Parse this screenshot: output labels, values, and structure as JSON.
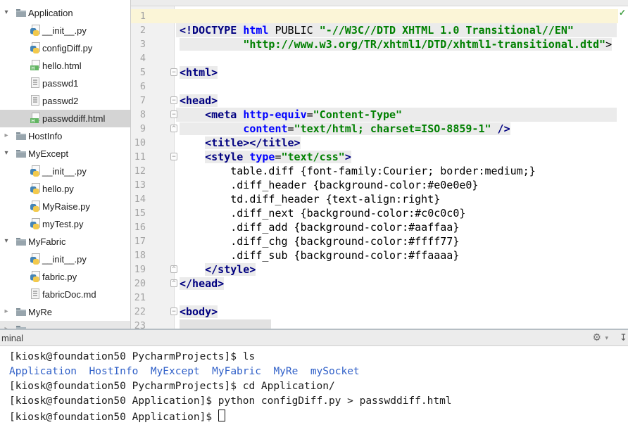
{
  "sidebar": {
    "items": [
      {
        "label": "Application",
        "icon": "folder-icon",
        "kind": "folder",
        "state": "expanded",
        "level": 0
      },
      {
        "label": "__init__.py",
        "icon": "python-file-icon",
        "kind": "file",
        "level": 1
      },
      {
        "label": "configDiff.py",
        "icon": "python-file-icon",
        "kind": "file",
        "level": 1
      },
      {
        "label": "hello.html",
        "icon": "html-file-icon",
        "kind": "file",
        "level": 1
      },
      {
        "label": "passwd1",
        "icon": "text-file-icon",
        "kind": "file",
        "level": 1
      },
      {
        "label": "passwd2",
        "icon": "text-file-icon",
        "kind": "file",
        "level": 1
      },
      {
        "label": "passwddiff.html",
        "icon": "html-file-icon",
        "kind": "file",
        "level": 1,
        "selected": true
      },
      {
        "label": "HostInfo",
        "icon": "folder-icon",
        "kind": "folder",
        "state": "collapsed",
        "level": 0
      },
      {
        "label": "MyExcept",
        "icon": "folder-icon",
        "kind": "folder",
        "state": "expanded",
        "level": 0
      },
      {
        "label": "__init__.py",
        "icon": "python-file-icon",
        "kind": "file",
        "level": 1
      },
      {
        "label": "hello.py",
        "icon": "python-file-icon",
        "kind": "file",
        "level": 1
      },
      {
        "label": "MyRaise.py",
        "icon": "python-file-icon",
        "kind": "file",
        "level": 1
      },
      {
        "label": "myTest.py",
        "icon": "python-file-icon",
        "kind": "file",
        "level": 1
      },
      {
        "label": "MyFabric",
        "icon": "folder-icon",
        "kind": "folder",
        "state": "expanded",
        "level": 0
      },
      {
        "label": "__init__.py",
        "icon": "python-file-icon",
        "kind": "file",
        "level": 1
      },
      {
        "label": "fabric.py",
        "icon": "python-file-icon",
        "kind": "file",
        "level": 1
      },
      {
        "label": "fabricDoc.md",
        "icon": "text-file-icon",
        "kind": "file",
        "level": 1
      },
      {
        "label": "MyRe",
        "icon": "folder-icon",
        "kind": "folder",
        "state": "collapsed",
        "level": 0
      },
      {
        "label": "",
        "icon": "folder-icon",
        "kind": "folder",
        "state": "collapsed",
        "level": 0,
        "partial": true
      }
    ]
  },
  "editor": {
    "inspection_icon": "inspections-ok-icon",
    "lines": [
      {
        "n": 1,
        "caret": true,
        "segs": []
      },
      {
        "n": 2,
        "bg": "full",
        "segs": [
          [
            "t",
            "<!DOCTYPE "
          ],
          [
            "k",
            "html"
          ],
          [
            "p",
            " PUBLIC "
          ],
          [
            "s",
            "\"-//W3C//DTD XHTML 1.0 Transitional//EN\""
          ]
        ]
      },
      {
        "n": 3,
        "hl": 0,
        "segs": [
          [
            "p",
            "          "
          ],
          [
            "s",
            "\"http://www.w3.org/TR/xhtml1/DTD/xhtml1-transitional.dtd\""
          ],
          [
            "p",
            ">"
          ]
        ]
      },
      {
        "n": 4,
        "segs": []
      },
      {
        "n": 5,
        "fold": "start",
        "hl": 0,
        "segs": [
          [
            "t",
            "<html>"
          ]
        ]
      },
      {
        "n": 6,
        "segs": []
      },
      {
        "n": 7,
        "fold": "start",
        "hl": 0,
        "segs": [
          [
            "t",
            "<head>"
          ]
        ]
      },
      {
        "n": 8,
        "fold": "start",
        "bg": "full",
        "segs": [
          [
            "p",
            "    "
          ],
          [
            "t",
            "<meta "
          ],
          [
            "a",
            "http-equiv"
          ],
          [
            "p",
            "="
          ],
          [
            "s",
            "\"Content-Type\""
          ]
        ]
      },
      {
        "n": 9,
        "fold": "end",
        "hl": 0,
        "segs": [
          [
            "p",
            "          "
          ],
          [
            "a",
            "content"
          ],
          [
            "p",
            "="
          ],
          [
            "s",
            "\"text/html; charset=ISO-8859-1\""
          ],
          [
            "t",
            " />"
          ]
        ]
      },
      {
        "n": 10,
        "hl": 1,
        "segs": [
          [
            "p",
            "    "
          ],
          [
            "t",
            "<title></title>"
          ]
        ]
      },
      {
        "n": 11,
        "fold": "start",
        "hl": 1,
        "segs": [
          [
            "p",
            "    "
          ],
          [
            "t",
            "<style "
          ],
          [
            "a",
            "type"
          ],
          [
            "p",
            "="
          ],
          [
            "s",
            "\"text/css\""
          ],
          [
            "t",
            ">"
          ]
        ]
      },
      {
        "n": 12,
        "segs": [
          [
            "p",
            "        table.diff {font-family:Courier; border:medium;}"
          ]
        ]
      },
      {
        "n": 13,
        "segs": [
          [
            "p",
            "        .diff_header {background-color:#e0e0e0}"
          ]
        ]
      },
      {
        "n": 14,
        "segs": [
          [
            "p",
            "        td.diff_header {text-align:right}"
          ]
        ]
      },
      {
        "n": 15,
        "segs": [
          [
            "p",
            "        .diff_next {background-color:#c0c0c0}"
          ]
        ]
      },
      {
        "n": 16,
        "segs": [
          [
            "p",
            "        .diff_add {background-color:#aaffaa}"
          ]
        ]
      },
      {
        "n": 17,
        "segs": [
          [
            "p",
            "        .diff_chg {background-color:#ffff77}"
          ]
        ]
      },
      {
        "n": 18,
        "segs": [
          [
            "p",
            "        .diff_sub {background-color:#ffaaaa}"
          ]
        ]
      },
      {
        "n": 19,
        "fold": "end",
        "hl": 1,
        "segs": [
          [
            "p",
            "    "
          ],
          [
            "t",
            "</style>"
          ]
        ]
      },
      {
        "n": 20,
        "fold": "end",
        "hl": 0,
        "segs": [
          [
            "t",
            "</head>"
          ]
        ]
      },
      {
        "n": 21,
        "segs": []
      },
      {
        "n": 22,
        "fold": "start",
        "hl": 0,
        "segs": [
          [
            "t",
            "<body>"
          ]
        ]
      },
      {
        "n": 23,
        "block": true,
        "segs": []
      }
    ]
  },
  "terminal": {
    "title": "minal",
    "icons": [
      "gear-icon",
      "dropdown-arrow-icon",
      "hide-panel-icon"
    ],
    "lines": [
      {
        "segs": [
          [
            "p",
            "[kiosk@foundation50 PycharmProjects]$ ls"
          ]
        ]
      },
      {
        "segs": [
          [
            "d",
            "Application"
          ],
          [
            "p",
            "  "
          ],
          [
            "d",
            "HostInfo"
          ],
          [
            "p",
            "  "
          ],
          [
            "d",
            "MyExcept"
          ],
          [
            "p",
            "  "
          ],
          [
            "d",
            "MyFabric"
          ],
          [
            "p",
            "  "
          ],
          [
            "d",
            "MyRe"
          ],
          [
            "p",
            "  "
          ],
          [
            "d",
            "mySocket"
          ]
        ]
      },
      {
        "segs": [
          [
            "p",
            "[kiosk@foundation50 PycharmProjects]$ cd Application/"
          ]
        ]
      },
      {
        "segs": [
          [
            "p",
            "[kiosk@foundation50 Application]$ python configDiff.py > passwddiff.html"
          ]
        ]
      },
      {
        "segs": [
          [
            "p",
            "[kiosk@foundation50 Application]$ "
          ]
        ],
        "cursor": true
      }
    ]
  },
  "colors": {
    "tag": "#000080",
    "attribute": "#0000ff",
    "string": "#008000",
    "caret_line": "#fbf5d7",
    "fragment_gray": "#ebebeb",
    "selected_row": "#d4d4d4",
    "terminal_dir_blue": "#3060c8",
    "html_icon_green": "#62b562",
    "python_icon_blue": "#4584b6",
    "python_icon_yellow": "#f2c94c",
    "inspection_green": "#3f9e3f"
  }
}
